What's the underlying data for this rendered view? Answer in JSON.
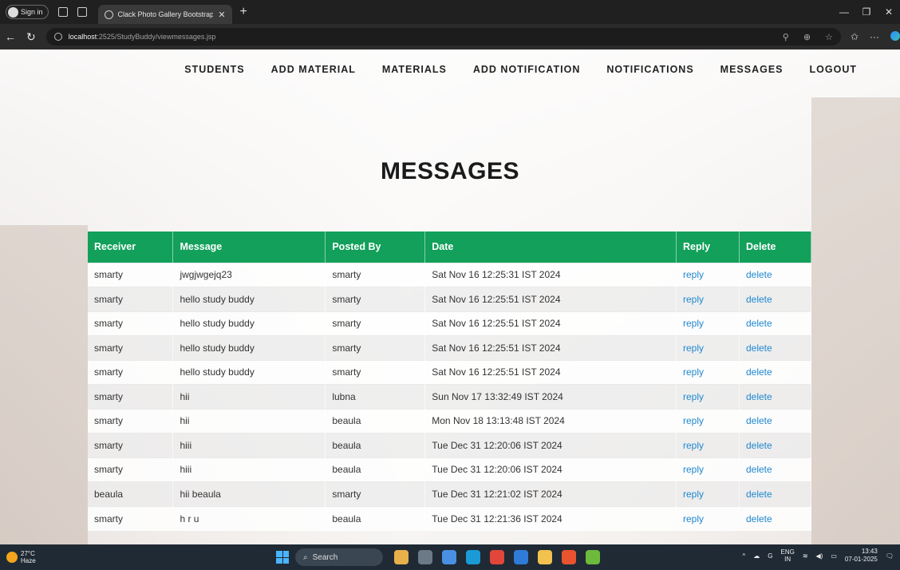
{
  "browser": {
    "profile_label": "Sign in",
    "tab_title": "Clack Photo Gallery Bootstrap Re",
    "url_host": "localhost",
    "url_path": ":2525/StudyBuddy/viewmessages.jsp"
  },
  "nav": {
    "items": [
      "STUDENTS",
      "ADD MATERIAL",
      "MATERIALS",
      "ADD NOTIFICATION",
      "NOTIFICATIONS",
      "MESSAGES",
      "LOGOUT"
    ]
  },
  "page": {
    "heading": "MESSAGES"
  },
  "table": {
    "headers": [
      "Receiver",
      "Message",
      "Posted By",
      "Date",
      "Reply",
      "Delete"
    ],
    "rows": [
      [
        "smarty",
        "jwgjwgejq23",
        "smarty",
        "Sat Nov 16 12:25:31 IST 2024",
        "reply",
        "delete"
      ],
      [
        "smarty",
        "hello study buddy",
        "smarty",
        "Sat Nov 16 12:25:51 IST 2024",
        "reply",
        "delete"
      ],
      [
        "smarty",
        "hello study buddy",
        "smarty",
        "Sat Nov 16 12:25:51 IST 2024",
        "reply",
        "delete"
      ],
      [
        "smarty",
        "hello study buddy",
        "smarty",
        "Sat Nov 16 12:25:51 IST 2024",
        "reply",
        "delete"
      ],
      [
        "smarty",
        "hello study buddy",
        "smarty",
        "Sat Nov 16 12:25:51 IST 2024",
        "reply",
        "delete"
      ],
      [
        "smarty",
        "hii",
        "lubna",
        "Sun Nov 17 13:32:49 IST 2024",
        "reply",
        "delete"
      ],
      [
        "smarty",
        "hii",
        "beaula",
        "Mon Nov 18 13:13:48 IST 2024",
        "reply",
        "delete"
      ],
      [
        "smarty",
        "hiii",
        "beaula",
        "Tue Dec 31 12:20:06 IST 2024",
        "reply",
        "delete"
      ],
      [
        "smarty",
        "hiii",
        "beaula",
        "Tue Dec 31 12:20:06 IST 2024",
        "reply",
        "delete"
      ],
      [
        "beaula",
        "hii beaula",
        "smarty",
        "Tue Dec 31 12:21:02 IST 2024",
        "reply",
        "delete"
      ],
      [
        "smarty",
        "h r u",
        "beaula",
        "Tue Dec 31 12:21:36 IST 2024",
        "reply",
        "delete"
      ]
    ]
  },
  "taskbar": {
    "weather_temp": "27°C",
    "weather_cond": "Haze",
    "search_label": "Search",
    "lang_top": "ENG",
    "lang_bottom": "IN",
    "time": "13:43",
    "date": "07-01-2025"
  },
  "colors": {
    "header_green": "#12a05a",
    "link_blue": "#1e88d0"
  }
}
